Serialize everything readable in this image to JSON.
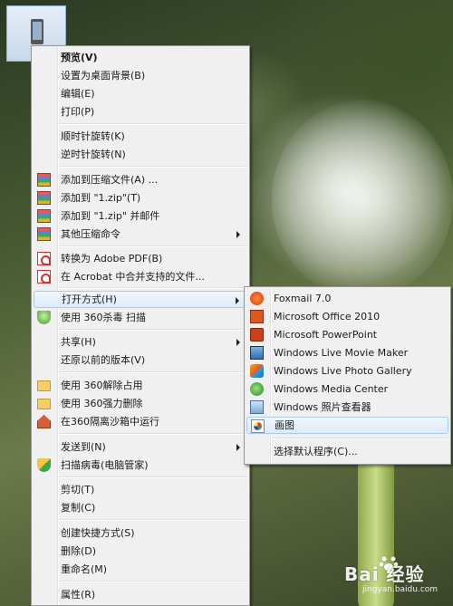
{
  "context_menu": {
    "items": [
      {
        "label": "预览(V)"
      },
      {
        "label": "设置为桌面背景(B)"
      },
      {
        "label": "编辑(E)"
      },
      {
        "label": "打印(P)"
      },
      {
        "label": "顺时针旋转(K)"
      },
      {
        "label": "逆时针旋转(N)"
      },
      {
        "label": "添加到压缩文件(A) ..."
      },
      {
        "label": "添加到 \"1.zip\"(T)"
      },
      {
        "label": "添加到 \"1.zip\" 并邮件"
      },
      {
        "label": "其他压缩命令"
      },
      {
        "label": "转换为 Adobe PDF(B)"
      },
      {
        "label": "在 Acrobat 中合并支持的文件..."
      },
      {
        "label": "打开方式(H)"
      },
      {
        "label": "使用 360杀毒 扫描"
      },
      {
        "label": "共享(H)"
      },
      {
        "label": "还原以前的版本(V)"
      },
      {
        "label": "使用 360解除占用"
      },
      {
        "label": "使用 360强力删除"
      },
      {
        "label": "在360隔离沙箱中运行"
      },
      {
        "label": "发送到(N)"
      },
      {
        "label": "扫描病毒(电脑管家)"
      },
      {
        "label": "剪切(T)"
      },
      {
        "label": "复制(C)"
      },
      {
        "label": "创建快捷方式(S)"
      },
      {
        "label": "删除(D)"
      },
      {
        "label": "重命名(M)"
      },
      {
        "label": "属性(R)"
      }
    ]
  },
  "open_with_submenu": {
    "items": [
      {
        "label": "Foxmail 7.0"
      },
      {
        "label": "Microsoft Office 2010"
      },
      {
        "label": "Microsoft PowerPoint"
      },
      {
        "label": "Windows Live Movie Maker"
      },
      {
        "label": "Windows Live Photo Gallery"
      },
      {
        "label": "Windows Media Center"
      },
      {
        "label": "Windows 照片查看器"
      },
      {
        "label": "画图"
      },
      {
        "label": "选择默认程序(C)..."
      }
    ]
  },
  "watermark": {
    "brand": "Bai 经验",
    "url": "jingyan.baidu.com"
  }
}
